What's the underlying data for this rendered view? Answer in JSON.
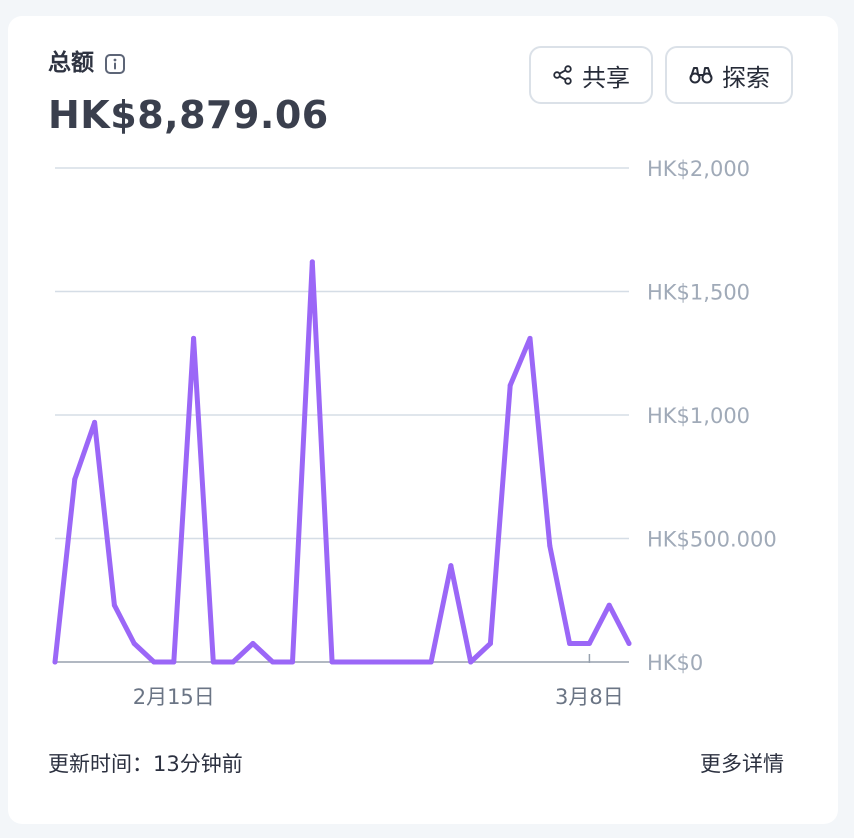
{
  "header": {
    "title": "总额",
    "total": "HK$8,879.06",
    "share_label": "共享",
    "explore_label": "探索"
  },
  "footer": {
    "updated_label": "更新时间：",
    "updated_value": "13分钟前",
    "more_details": "更多详情"
  },
  "colors": {
    "line": "#9b67f7",
    "grid": "#d5dde6",
    "axis_text": "#a0aab8"
  },
  "chart_data": {
    "type": "line",
    "title": "",
    "xlabel": "",
    "ylabel": "",
    "ylim": [
      0,
      2000
    ],
    "y_ticks": [
      "HK$0",
      "HK$500.000",
      "HK$1,000",
      "HK$1,500",
      "HK$2,000"
    ],
    "y_tick_values": [
      0,
      500,
      1000,
      1500,
      2000
    ],
    "x_ticks": [
      "2月15日",
      "3月8日"
    ],
    "x_tick_index": [
      6,
      27
    ],
    "legend": "none",
    "grid": true,
    "series": [
      {
        "values": [
          0,
          740,
          970,
          230,
          75,
          0,
          0,
          1310,
          0,
          0,
          75,
          0,
          0,
          1620,
          0,
          0,
          0,
          0,
          0,
          0,
          390,
          0,
          75,
          1120,
          1310,
          470,
          75,
          75,
          230,
          75
        ]
      }
    ]
  }
}
